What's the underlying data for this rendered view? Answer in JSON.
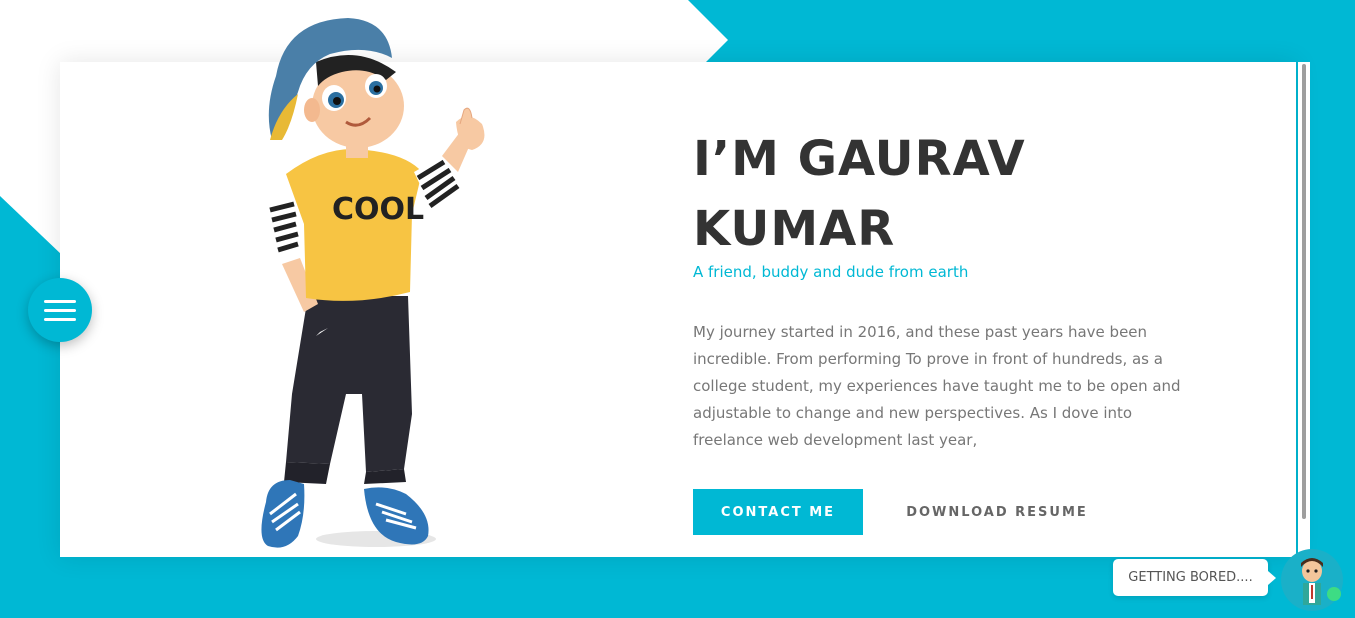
{
  "hero": {
    "title": "I’M GAURAV KUMAR",
    "subtitle": "A friend, buddy and dude from earth",
    "bio": "My journey started in 2016, and these past years have been incredible. From performing To prove in front of hundreds, as a college student, my experiences have taught me to be open and adjustable to change and new perspectives. As I dove into freelance web development last year,",
    "contact_label": "CONTACT ME",
    "download_label": "DOWNLOAD RESUME",
    "shirt_text": "COOL"
  },
  "chat": {
    "bubble_text": "GETTING BORED...."
  },
  "icons": {
    "menu": "hamburger-menu-icon",
    "chat_avatar": "assistant-avatar-icon",
    "online": "online-status-icon"
  },
  "colors": {
    "accent": "#00b8d4",
    "title": "#333333",
    "body_text": "#777777",
    "online": "#3ddc84"
  }
}
